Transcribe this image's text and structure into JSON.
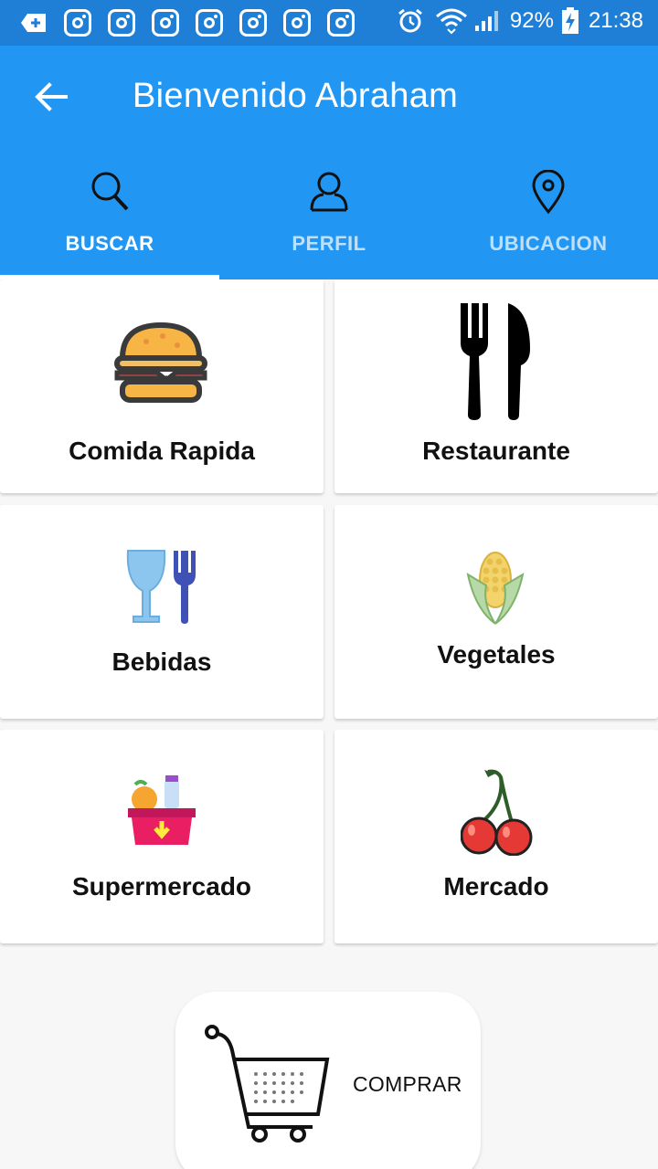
{
  "status_bar": {
    "battery": "92%",
    "time": "21:38",
    "icons": [
      "add-notification-icon",
      "instagram-icon",
      "alarm-icon",
      "wifi-icon",
      "signal-icon",
      "battery-charging-icon"
    ]
  },
  "app_bar": {
    "title": "Bienvenido Abraham"
  },
  "tabs": [
    {
      "label": "BUSCAR",
      "icon": "search-icon",
      "active": true
    },
    {
      "label": "PERFIL",
      "icon": "person-icon",
      "active": false
    },
    {
      "label": "UBICACION",
      "icon": "location-pin-icon",
      "active": false
    }
  ],
  "categories": [
    {
      "label": "Comida Rapida",
      "icon": "burger-icon"
    },
    {
      "label": "Restaurante",
      "icon": "fork-knife-icon"
    },
    {
      "label": "Bebidas",
      "icon": "glass-fork-icon"
    },
    {
      "label": "Vegetales",
      "icon": "corn-icon"
    },
    {
      "label": "Supermercado",
      "icon": "grocery-basket-icon"
    },
    {
      "label": "Mercado",
      "icon": "cherries-icon"
    }
  ],
  "buy_button": {
    "label": "COMPRAR",
    "icon": "shopping-cart-icon"
  },
  "colors": {
    "status_bar": "#1f7fd6",
    "app_bar": "#2196f3",
    "background": "#f7f7f7"
  }
}
